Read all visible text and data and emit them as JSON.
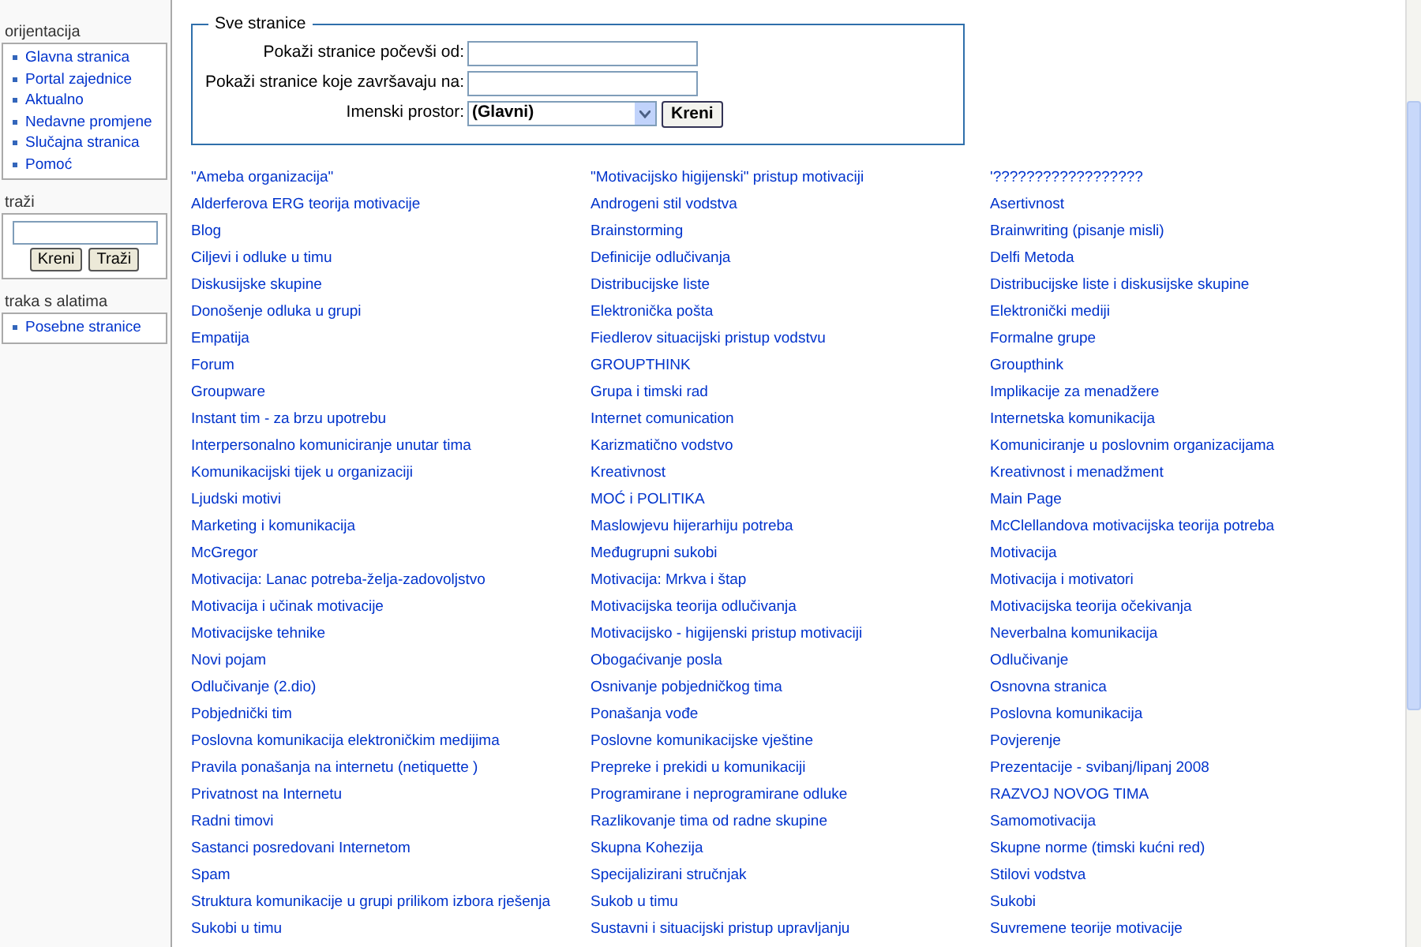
{
  "sidebar": [
    {
      "kind": "links",
      "title": "orijentacija",
      "items": [
        "Glavna stranica",
        "Portal zajednice",
        "Aktualno",
        "Nedavne promjene",
        "Slučajna stranica",
        "Pomoć"
      ]
    },
    {
      "kind": "search",
      "title": "traži",
      "buttons": [
        "Kreni",
        "Traži"
      ]
    },
    {
      "kind": "links",
      "title": "traka s alatima",
      "items": [
        "Posebne stranice"
      ]
    }
  ],
  "form": {
    "legend": "Sve stranice",
    "fields": [
      {
        "kind": "text",
        "label": "Pokaži stranice počevši od:"
      },
      {
        "kind": "text",
        "label": "Pokaži stranice koje završavaju na:"
      },
      {
        "kind": "select",
        "label": "Imenski prostor:",
        "value": "(Glavni)",
        "button": "Kreni"
      }
    ]
  },
  "columns": [
    [
      "\"Ameba organizacija\"",
      "Alderferova ERG teorija motivacije",
      "Blog",
      "Ciljevi i odluke u timu",
      "Diskusijske skupine",
      "Donošenje odluka u grupi",
      "Empatija",
      "Forum",
      "Groupware",
      "Instant tim - za brzu upotrebu",
      "Interpersonalno komuniciranje unutar tima",
      "Komunikacijski tijek u organizaciji",
      "Ljudski motivi",
      "Marketing i komunikacija",
      "McGregor",
      "Motivacija: Lanac potreba-želja-zadovoljstvo",
      "Motivacija i učinak motivacije",
      "Motivacijske tehnike",
      "Novi pojam",
      "Odlučivanje (2.dio)",
      "Pobjednički tim",
      "Poslovna komunikacija elektroničkim medijima",
      "Pravila ponašanja na internetu (netiquette )",
      "Privatnost na Internetu",
      "Radni timovi",
      "Sastanci posredovani Internetom",
      "Spam",
      "Struktura komunikacije u grupi prilikom izbora rješenja",
      "Sukobi u timu"
    ],
    [
      "\"Motivacijsko higijenski\" pristup motivaciji",
      "Androgeni stil vodstva",
      "Brainstorming",
      "Definicije odlučivanja",
      "Distribucijske liste",
      "Elektronička pošta",
      "Fiedlerov situacijski pristup vodstvu",
      "GROUPTHINK",
      "Grupa i timski rad",
      "Internet comunication",
      "Karizmatično vodstvo",
      "Kreativnost",
      "MOĆ i POLITIKA",
      "Maslowjevu hijerarhiju potreba",
      "Međugrupni sukobi",
      "Motivacija: Mrkva i štap",
      "Motivacijska teorija odlučivanja",
      "Motivacijsko - higijenski pristup motivaciji",
      "Obogaćivanje posla",
      "Osnivanje pobjedničkog tima",
      "Ponašanja vođe",
      "Poslovne komunikacijske vještine",
      "Prepreke i prekidi u komunikaciji",
      "Programirane i neprogramirane odluke",
      "Razlikovanje tima od radne skupine",
      "Skupna Kohezija",
      "Specijalizirani stručnjak",
      "Sukob u timu",
      "Sustavni i situacijski pristup upravljanju"
    ],
    [
      "'??????????????????",
      "Asertivnost",
      "Brainwriting (pisanje misli)",
      "Delfi Metoda",
      "Distribucijske liste i diskusijske skupine",
      "Elektronički mediji",
      "Formalne grupe",
      "Groupthink",
      "Implikacije za menadžere",
      "Internetska komunikacija",
      "Komuniciranje u poslovnim organizacijama",
      "Kreativnost i menadžment",
      "Main Page",
      "McClellandova motivacijska teorija potreba",
      "Motivacija",
      "Motivacija i motivatori",
      "Motivacijska teorija očekivanja",
      "Neverbalna komunikacija",
      "Odlučivanje",
      "Osnovna stranica",
      "Poslovna komunikacija",
      "Povjerenje",
      "Prezentacije - svibanj/lipanj 2008",
      "RAZVOJ NOVOG TIMA",
      "Samomotivacija",
      "Skupne norme (timski kućni red)",
      "Stilovi vodstva",
      "Sukobi",
      "Suvremene teorije motivacije"
    ]
  ]
}
